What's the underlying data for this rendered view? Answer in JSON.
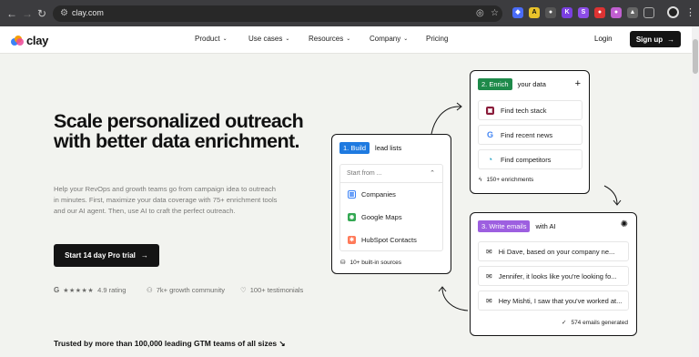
{
  "browser": {
    "url": "clay.com",
    "back_icon": "arrow-left-icon",
    "forward_icon": "arrow-right-icon",
    "reload_icon": "reload-icon"
  },
  "header": {
    "logo_text": "clay",
    "menu": [
      {
        "label": "Product"
      },
      {
        "label": "Use cases"
      },
      {
        "label": "Resources"
      },
      {
        "label": "Company"
      },
      {
        "label": "Pricing"
      }
    ],
    "login_label": "Login",
    "signup_label": "Sign up"
  },
  "hero": {
    "title": "Scale personalized outreach with better data enrichment.",
    "subtitle": "Help your RevOps and growth teams go from campaign idea to outreach in minutes. First, maximize your data coverage with 75+ enrichment tools and our AI agent. Then, use AI to craft the perfect outreach.",
    "cta_label": "Start 14 day Pro trial",
    "rating_text": "4.9 rating",
    "rating_stars": 5,
    "community_text": "7k+ growth community",
    "testimonials_text": "100+ testimonials",
    "trusted_text": "Trusted by more than 100,000 leading GTM teams of all sizes"
  },
  "build_card": {
    "tag": "1. Build",
    "title": "lead lists",
    "select_placeholder": "Start from ...",
    "options": [
      {
        "label": "Companies",
        "icon": "building-icon"
      },
      {
        "label": "Google Maps",
        "icon": "google-maps-icon"
      },
      {
        "label": "HubSpot Contacts",
        "icon": "hubspot-icon"
      }
    ],
    "footer": "10+ built-in sources"
  },
  "enrich_card": {
    "tag": "2. Enrich",
    "title": "your data",
    "rows": [
      {
        "label": "Find tech stack",
        "icon": "tech-stack-icon"
      },
      {
        "label": "Find recent news",
        "icon": "google-icon"
      },
      {
        "label": "Find competitors",
        "icon": "competitors-icon"
      }
    ],
    "footer": "150+ enrichments"
  },
  "emails_card": {
    "tag": "3. Write emails",
    "title": "with AI",
    "rows": [
      {
        "label": "Hi Dave, based on your company ne..."
      },
      {
        "label": "Jennifer, it looks like you're looking fo..."
      },
      {
        "label": "Hey Mishti, I saw that you've worked at..."
      }
    ],
    "footer": "574 emails generated"
  },
  "colors": {
    "build_tag": "#1f7ae0",
    "enrich_tag": "#1e8a4a",
    "emails_tag": "#9d5fe0",
    "background": "#f2f3ef",
    "dark": "#141414"
  }
}
